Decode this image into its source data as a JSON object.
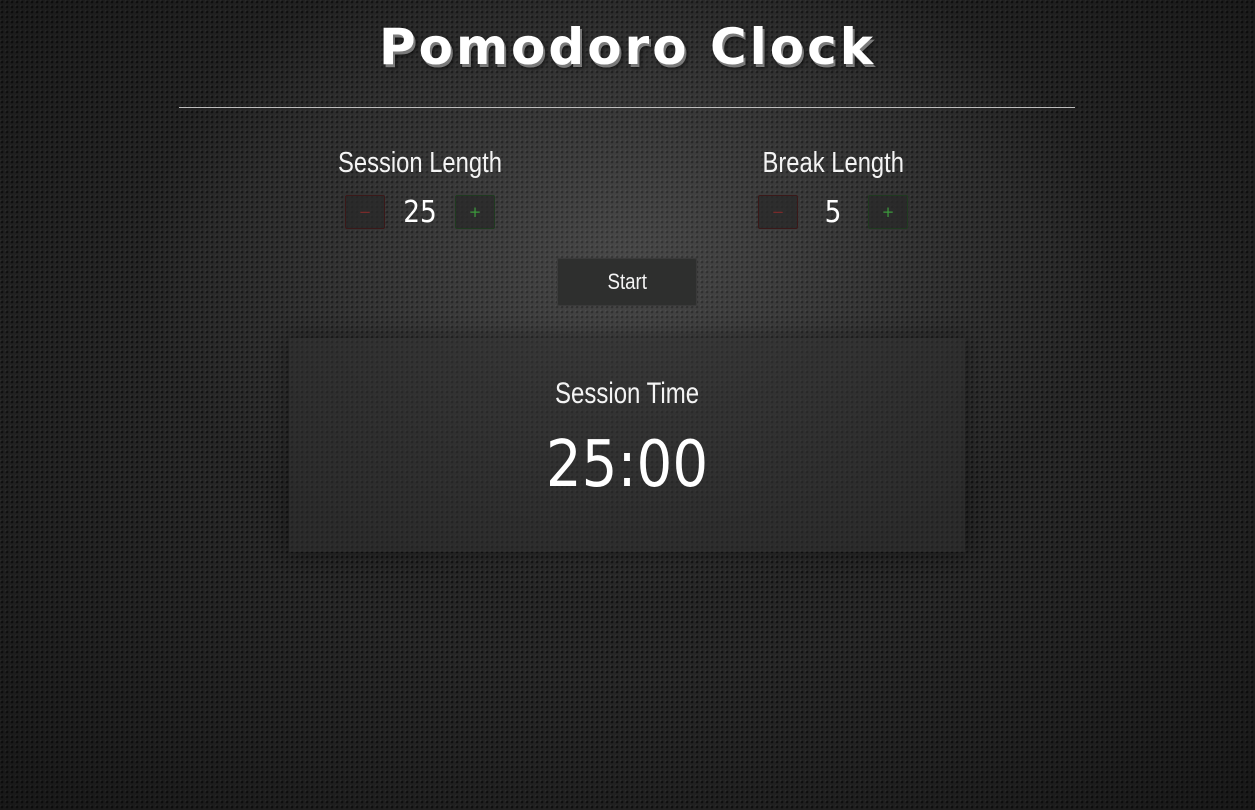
{
  "app": {
    "title": "Pomodoro Clock"
  },
  "session": {
    "label": "Session Length",
    "value": "25",
    "decrement_label": "−",
    "increment_label": "+"
  },
  "break": {
    "label": "Break Length",
    "value": "5",
    "decrement_label": "−",
    "increment_label": "+"
  },
  "controls": {
    "start_label": "Start"
  },
  "timer": {
    "label": "Session Time",
    "value": "25:00"
  },
  "colors": {
    "accent_decrement": "#7a2a2a",
    "accent_increment": "#3c9a3c",
    "text": "#f4f4f4"
  }
}
